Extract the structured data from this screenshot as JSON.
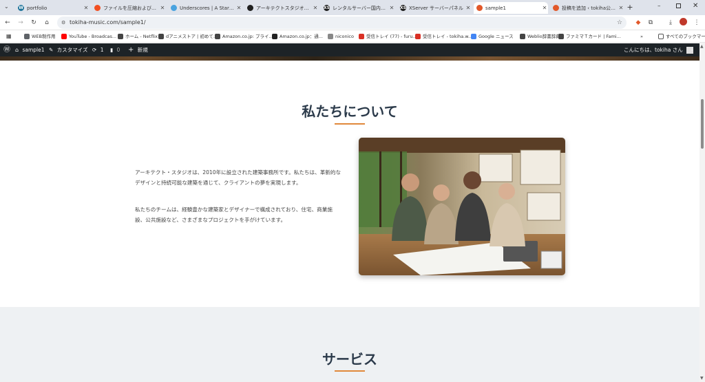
{
  "browser": {
    "tabs": [
      {
        "title": "portfolio",
        "color": "#21759b",
        "glyph": "W"
      },
      {
        "title": "ファイルを圧縮および展開する",
        "color": "#f25022",
        "glyph": ""
      },
      {
        "title": "Underscores | A Starter Th",
        "color": "#4aa3df",
        "glyph": ""
      },
      {
        "title": "アーキテクトスタジオのデザイン",
        "color": "#202020",
        "glyph": ""
      },
      {
        "title": "レンタルサーバー国内シェアN",
        "color": "#1a1a1a",
        "glyph": "XS"
      },
      {
        "title": "XServer サーバーパネル",
        "color": "#1a1a1a",
        "glyph": "XS"
      },
      {
        "title": "sample1",
        "color": "#e2582a",
        "glyph": ""
      },
      {
        "title": "投稿を追加 ‹ tokiha公式サ",
        "color": "#e2582a",
        "glyph": ""
      }
    ],
    "new_tab": "+",
    "url": "tokiha-music.com/sample1/",
    "bookmarks": [
      {
        "label": "WEB制作用",
        "color": "#5f6368"
      },
      {
        "label": "YouTube - Broadcas...",
        "color": "#ff0000"
      },
      {
        "label": "ホーム - Netflix",
        "color": "#444"
      },
      {
        "label": "dアニメストア | 初めて...",
        "color": "#444"
      },
      {
        "label": "Amazon.co.jp: プライ...",
        "color": "#444"
      },
      {
        "label": "Amazon.co.jp：通...",
        "color": "#222"
      },
      {
        "label": "niconico",
        "color": "#888"
      },
      {
        "label": "受信トレイ (77) - furu...",
        "color": "#d93025"
      },
      {
        "label": "受信トレイ - tokiha.w...",
        "color": "#d93025"
      },
      {
        "label": "Google ニュース",
        "color": "#4285f4"
      },
      {
        "label": "Weblio辞書辞典",
        "color": "#444"
      },
      {
        "label": "ファミマＴカード | Fami...",
        "color": "#444"
      }
    ],
    "bookmarks_more": "»",
    "all_bookmarks": "すべてのブックマーク"
  },
  "wp_admin_bar": {
    "site_name": "sample1",
    "customize": "カスタマイズ",
    "updates_count": "1",
    "comments_count": "0",
    "new_label": "新規",
    "greeting": "こんにちは、tokiha さん"
  },
  "about": {
    "title": "私たちについて",
    "para1": "アーキテクト・スタジオは、2010年に設立された建築事務所です。私たちは、革新的なデザインと持続可能な建築を通じて、クライアントの夢を実現します。",
    "para2": "私たちのチームは、経験豊かな建築家とデザイナーで構成されており、住宅、商業施設、公共施設など、さまざまなプロジェクトを手がけています。"
  },
  "services": {
    "title": "サービス"
  },
  "colors": {
    "accent": "#e0883a",
    "heading": "#2b3a4a",
    "admin_bar": "#1d2327"
  }
}
